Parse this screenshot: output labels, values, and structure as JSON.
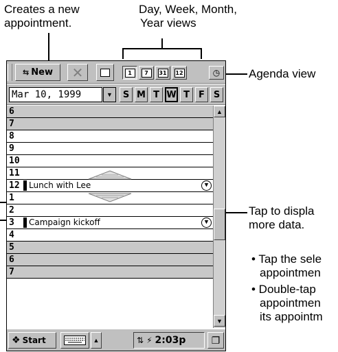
{
  "callouts": {
    "new_appt": [
      "Creates a new",
      "appointment."
    ],
    "views": [
      "Day, Week, Month,",
      "Year views"
    ],
    "agenda": "Agenda view",
    "tap_display": [
      "Tap to displa",
      "more data."
    ],
    "bullet1": [
      "• Tap the sele",
      "appointmen"
    ],
    "bullet2": [
      "• Double-tap",
      "appointmen",
      "its appointm"
    ]
  },
  "toolbar": {
    "new_label": "New",
    "view_buttons": [
      "1",
      "7",
      "31",
      "12"
    ]
  },
  "date": {
    "value": "Mar 10, 1999",
    "days": [
      "S",
      "M",
      "T",
      "W",
      "T",
      "F",
      "S"
    ]
  },
  "rows": [
    {
      "hour": "6",
      "text": ""
    },
    {
      "hour": "7",
      "text": ""
    },
    {
      "hour": "8",
      "text": ""
    },
    {
      "hour": "9",
      "text": ""
    },
    {
      "hour": "10",
      "text": ""
    },
    {
      "hour": "11",
      "text": ""
    },
    {
      "hour": "12",
      "text": "Lunch with Lee"
    },
    {
      "hour": "1",
      "text": ""
    },
    {
      "hour": "2",
      "text": ""
    },
    {
      "hour": "3",
      "text": "Campaign kickoff"
    },
    {
      "hour": "4",
      "text": ""
    },
    {
      "hour": "5",
      "text": ""
    },
    {
      "hour": "6",
      "text": ""
    },
    {
      "hour": "7",
      "text": ""
    }
  ],
  "taskbar": {
    "start": "Start",
    "time": "2:03p"
  }
}
